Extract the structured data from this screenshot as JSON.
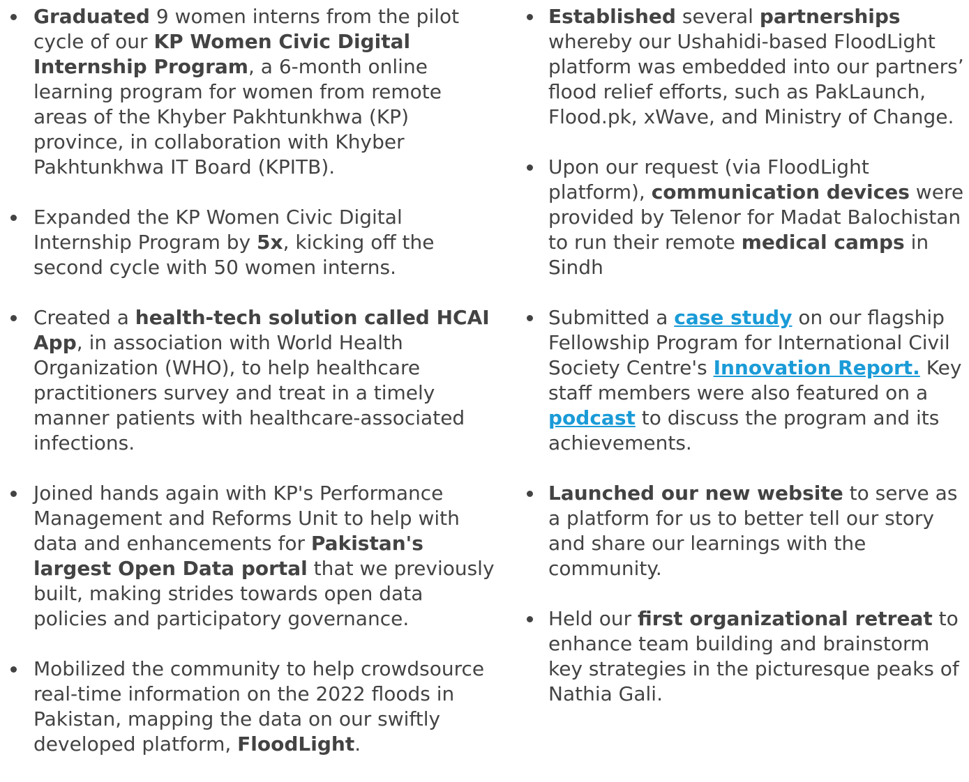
{
  "left_column": [
    {
      "segments": [
        {
          "text": "Graduated",
          "style": "bold"
        },
        {
          "text": " 9 women interns from the pilot cycle of our ",
          "style": "normal"
        },
        {
          "text": "KP Women Civic Digital Internship Program",
          "style": "bold"
        },
        {
          "text": ", a 6-month online learning program for women from remote areas of the Khyber Pakhtunkhwa (KP) province, in collaboration with Khyber Pakhtunkhwa IT Board (KPITB).",
          "style": "normal"
        }
      ]
    },
    {
      "segments": [
        {
          "text": "Expanded the KP Women Civic Digital Internship Program by ",
          "style": "normal"
        },
        {
          "text": "5x",
          "style": "bold"
        },
        {
          "text": ", kicking off the second cycle with 50 women interns.",
          "style": "normal"
        }
      ]
    },
    {
      "segments": [
        {
          "text": "Created a ",
          "style": "normal"
        },
        {
          "text": "health-tech solution called HCAI App",
          "style": "bold"
        },
        {
          "text": ", in association with World Health Organization (WHO), to help healthcare practitioners survey and treat in a timely manner patients with healthcare-associated infections.",
          "style": "normal"
        }
      ]
    },
    {
      "segments": [
        {
          "text": "Joined hands again with KP's Performance Management and Reforms Unit to help with data and enhancements for ",
          "style": "normal"
        },
        {
          "text": "Pakistan's largest Open Data portal",
          "style": "bold"
        },
        {
          "text": " that we previously built, making strides towards open data policies and participatory governance.",
          "style": "normal"
        }
      ]
    },
    {
      "segments": [
        {
          "text": "Mobilized the community to help crowdsource real-time information on the 2022 floods in Pakistan, mapping the data on our swiftly developed platform, ",
          "style": "normal"
        },
        {
          "text": "FloodLight",
          "style": "bold"
        },
        {
          "text": ".",
          "style": "normal"
        }
      ]
    }
  ],
  "right_column": [
    {
      "segments": [
        {
          "text": "Established",
          "style": "bold"
        },
        {
          "text": " several ",
          "style": "normal"
        },
        {
          "text": "partnerships",
          "style": "bold"
        },
        {
          "text": " whereby our Ushahidi-based FloodLight platform was embedded into our partners’ flood relief efforts, such as PakLaunch, Flood.pk, xWave, and Ministry of Change.",
          "style": "normal"
        }
      ]
    },
    {
      "segments": [
        {
          "text": "Upon our request (via FloodLight platform), ",
          "style": "normal"
        },
        {
          "text": "communication devices",
          "style": "bold"
        },
        {
          "text": " were provided by Telenor for Madat Balochistan to run their remote ",
          "style": "normal"
        },
        {
          "text": "medical camps",
          "style": "bold"
        },
        {
          "text": " in Sindh",
          "style": "normal"
        }
      ]
    },
    {
      "segments": [
        {
          "text": "Submitted a ",
          "style": "normal"
        },
        {
          "text": "case study",
          "style": "link"
        },
        {
          "text": " on our flagship Fellowship Program for International Civil Society Centre's ",
          "style": "normal"
        },
        {
          "text": "Innovation Report.",
          "style": "link"
        },
        {
          "text": " Key staff members were also featured on a ",
          "style": "normal"
        },
        {
          "text": "podcast",
          "style": "link"
        },
        {
          "text": " to discuss the program and its achievements.",
          "style": "normal"
        }
      ]
    },
    {
      "segments": [
        {
          "text": "Launched our new website",
          "style": "bold"
        },
        {
          "text": " to serve as a platform for us to better tell our story and share our learnings with the community.",
          "style": "normal"
        }
      ]
    },
    {
      "segments": [
        {
          "text": "Held our ",
          "style": "normal"
        },
        {
          "text": "first organizational retreat",
          "style": "bold"
        },
        {
          "text": " to enhance team building and brainstorm key strategies in the picturesque peaks of Nathia Gali.",
          "style": "normal"
        }
      ]
    }
  ],
  "colors": {
    "text": "#434343",
    "link": "#1a9bd7",
    "bullet": "#434343"
  }
}
